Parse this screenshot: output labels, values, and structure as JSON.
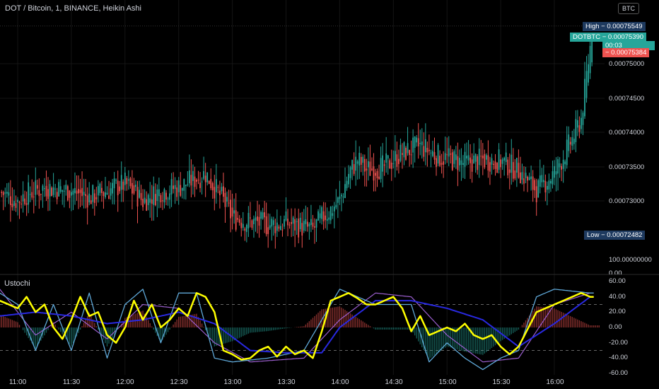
{
  "header": {
    "title": "DOT / Bitcoin, 1, BINANCE, Heikin Ashi",
    "currency": "BTC"
  },
  "price_tags": {
    "high": "High − 0.00075549",
    "symbol": "DOTBTC − 0.00075390",
    "countdown": "00:03",
    "last": "− 0.00075384",
    "low": "Low − 0.00072482"
  },
  "price_axis": [
    "0.00075000",
    "0.00074500",
    "0.00074000",
    "0.00073500",
    "0.00073000"
  ],
  "indicator": {
    "name": "Ustochi",
    "scale_top": "100.00000000",
    "scale_zero": "0.00",
    "axis": [
      "60.00",
      "40.00",
      "20.00",
      "0.00",
      "-20.00",
      "-40.00",
      "-60.00"
    ]
  },
  "time_axis": [
    "11:00",
    "11:30",
    "12:00",
    "12:30",
    "13:00",
    "13:30",
    "14:00",
    "14:30",
    "15:00",
    "15:30",
    "16:00"
  ],
  "colors": {
    "up": "#26a69a",
    "down": "#ef5350",
    "yellow": "#ffff00",
    "signal": "#2929e0",
    "lightblue": "#5fa8d8",
    "purple": "#9c5fd0"
  },
  "chart_data": {
    "type": "candlestick",
    "title": "DOT / Bitcoin, 1, BINANCE, Heikin Ashi",
    "ylim": [
      0.000722,
      0.000757
    ],
    "price_keypoints_min_from_1100": [
      [
        -10,
        0.0007313
      ],
      [
        0,
        0.00073
      ],
      [
        5,
        0.000731
      ],
      [
        15,
        0.000732
      ],
      [
        30,
        0.0007315
      ],
      [
        40,
        0.0007305
      ],
      [
        60,
        0.0007325
      ],
      [
        70,
        0.00073
      ],
      [
        80,
        0.0007315
      ],
      [
        90,
        0.000732
      ],
      [
        105,
        0.000734
      ],
      [
        115,
        0.00073
      ],
      [
        120,
        0.0007275
      ],
      [
        130,
        0.000727
      ],
      [
        140,
        0.0007265
      ],
      [
        150,
        0.0007268
      ],
      [
        165,
        0.0007258
      ],
      [
        170,
        0.0007275
      ],
      [
        180,
        0.00073
      ],
      [
        185,
        0.000734
      ],
      [
        190,
        0.000736
      ],
      [
        195,
        0.0007345
      ],
      [
        205,
        0.000735
      ],
      [
        215,
        0.000737
      ],
      [
        225,
        0.000738
      ],
      [
        235,
        0.0007365
      ],
      [
        250,
        0.0007355
      ],
      [
        260,
        0.000736
      ],
      [
        270,
        0.0007358
      ],
      [
        280,
        0.0007345
      ],
      [
        290,
        0.0007315
      ],
      [
        300,
        0.000734
      ],
      [
        310,
        0.000739
      ],
      [
        315,
        0.000742
      ],
      [
        321,
        0.0007545
      ]
    ],
    "oscillator": {
      "ylim": [
        -65,
        65
      ],
      "levels": [
        30,
        -30
      ],
      "yellow": [
        [
          -10,
          35
        ],
        [
          0,
          25
        ],
        [
          5,
          40
        ],
        [
          10,
          20
        ],
        [
          15,
          30
        ],
        [
          20,
          0
        ],
        [
          25,
          -15
        ],
        [
          30,
          10
        ],
        [
          35,
          40
        ],
        [
          40,
          15
        ],
        [
          45,
          20
        ],
        [
          50,
          -10
        ],
        [
          55,
          -20
        ],
        [
          60,
          0
        ],
        [
          65,
          35
        ],
        [
          70,
          10
        ],
        [
          75,
          30
        ],
        [
          80,
          0
        ],
        [
          85,
          10
        ],
        [
          90,
          25
        ],
        [
          95,
          15
        ],
        [
          100,
          45
        ],
        [
          105,
          40
        ],
        [
          110,
          20
        ],
        [
          115,
          -30
        ],
        [
          120,
          -35
        ],
        [
          125,
          -42
        ],
        [
          130,
          -40
        ],
        [
          135,
          -30
        ],
        [
          140,
          -25
        ],
        [
          145,
          -38
        ],
        [
          150,
          -25
        ],
        [
          155,
          -35
        ],
        [
          160,
          -30
        ],
        [
          165,
          -40
        ],
        [
          170,
          -5
        ],
        [
          175,
          35
        ],
        [
          180,
          40
        ],
        [
          185,
          45
        ],
        [
          190,
          38
        ],
        [
          195,
          30
        ],
        [
          200,
          30
        ],
        [
          205,
          35
        ],
        [
          210,
          40
        ],
        [
          215,
          25
        ],
        [
          220,
          -5
        ],
        [
          225,
          15
        ],
        [
          230,
          -10
        ],
        [
          235,
          -5
        ],
        [
          240,
          0
        ],
        [
          245,
          -5
        ],
        [
          250,
          5
        ],
        [
          255,
          -10
        ],
        [
          260,
          -15
        ],
        [
          265,
          -10
        ],
        [
          270,
          -25
        ],
        [
          275,
          -35
        ],
        [
          280,
          -25
        ],
        [
          290,
          20
        ],
        [
          300,
          30
        ],
        [
          305,
          35
        ],
        [
          310,
          40
        ],
        [
          315,
          45
        ],
        [
          320,
          40
        ]
      ],
      "signal": [
        [
          -10,
          15
        ],
        [
          10,
          20
        ],
        [
          30,
          15
        ],
        [
          50,
          5
        ],
        [
          70,
          10
        ],
        [
          90,
          20
        ],
        [
          110,
          5
        ],
        [
          130,
          -30
        ],
        [
          150,
          -33
        ],
        [
          170,
          -33
        ],
        [
          180,
          0
        ],
        [
          200,
          35
        ],
        [
          220,
          35
        ],
        [
          240,
          25
        ],
        [
          260,
          10
        ],
        [
          280,
          -25
        ],
        [
          300,
          5
        ],
        [
          320,
          40
        ]
      ],
      "lightblue": [
        [
          -10,
          45
        ],
        [
          0,
          30
        ],
        [
          10,
          -30
        ],
        [
          20,
          30
        ],
        [
          30,
          -30
        ],
        [
          40,
          45
        ],
        [
          50,
          -40
        ],
        [
          60,
          30
        ],
        [
          70,
          50
        ],
        [
          80,
          -20
        ],
        [
          90,
          45
        ],
        [
          100,
          45
        ],
        [
          110,
          -40
        ],
        [
          120,
          -45
        ],
        [
          140,
          -40
        ],
        [
          160,
          -30
        ],
        [
          170,
          10
        ],
        [
          180,
          50
        ],
        [
          190,
          40
        ],
        [
          200,
          30
        ],
        [
          220,
          30
        ],
        [
          230,
          -45
        ],
        [
          240,
          -20
        ],
        [
          250,
          -40
        ],
        [
          260,
          -55
        ],
        [
          270,
          -40
        ],
        [
          280,
          -30
        ],
        [
          290,
          40
        ],
        [
          300,
          50
        ],
        [
          320,
          45
        ]
      ],
      "purple": [
        [
          -10,
          50
        ],
        [
          10,
          -10
        ],
        [
          30,
          20
        ],
        [
          50,
          -15
        ],
        [
          70,
          30
        ],
        [
          90,
          25
        ],
        [
          110,
          -20
        ],
        [
          130,
          -45
        ],
        [
          160,
          -40
        ],
        [
          180,
          10
        ],
        [
          200,
          45
        ],
        [
          220,
          40
        ],
        [
          240,
          -10
        ],
        [
          260,
          -45
        ],
        [
          280,
          -40
        ],
        [
          300,
          30
        ],
        [
          320,
          45
        ]
      ]
    }
  }
}
